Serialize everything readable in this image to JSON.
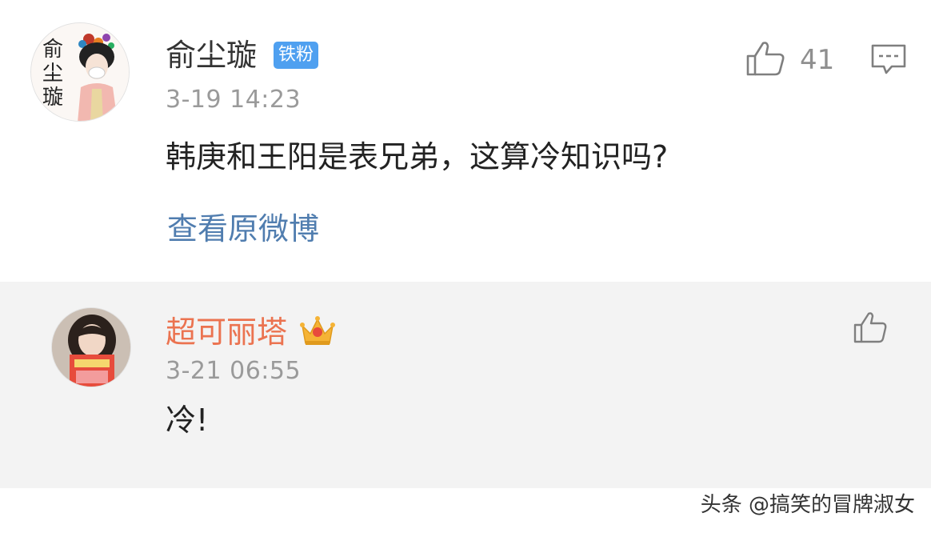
{
  "comment": {
    "username": "俞尘璇",
    "badge": "铁粉",
    "avatar_text": "俞尘璇",
    "time": "3-19 14:23",
    "text": "韩庚和王阳是表兄弟，这算冷知识吗?",
    "likes": "41",
    "view_original": "查看原微博"
  },
  "reply": {
    "username": "超可丽塔",
    "time": "3-21 06:55",
    "text": "冷!"
  },
  "watermark": "头条 @搞笑的冒牌淑女",
  "colors": {
    "reply_username": "#eb7350",
    "link": "#507daf",
    "badge_bg": "#4fa0f0",
    "reply_bg": "#f3f3f3"
  },
  "icons": [
    "thumbs-up-icon",
    "comment-icon",
    "crown-icon"
  ]
}
